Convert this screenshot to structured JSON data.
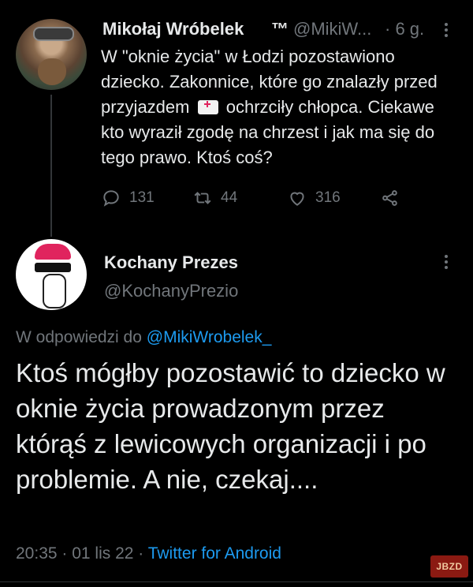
{
  "tweet1": {
    "author_name": "Mikołaj Wróbelek",
    "trademark": "™",
    "handle": "@MikiW...",
    "time": "· 6 g.",
    "text_before_emoji": "W \"oknie życia\" w Łodzi pozostawiono dziecko. Zakonnice, które go znalazły przed przyjazdem",
    "emoji_icon": "ambulance-icon",
    "text_after_emoji": "ochrzciły chłopca. Ciekawe kto wyraził zgodę na chrzest i jak ma się do tego prawo. Ktoś coś?",
    "replies": "131",
    "retweets": "44",
    "likes": "316"
  },
  "tweet2": {
    "author_name": "Kochany Prezes",
    "handle": "@KochanyPrezio",
    "reply_prefix": "W odpowiedzi do ",
    "reply_mention": "@MikiWrobelek_",
    "text": "Ktoś mógłby pozostawić to dziecko w oknie życia prowadzonym przez którąś z lewicowych organizacji i po problemie. A nie, czekaj....",
    "time": "20:35 · 01 lis 22 · ",
    "source": "Twitter for Android"
  },
  "watermark": "JBZD",
  "colors": {
    "background": "#000000",
    "text": "#e7e9ea",
    "muted": "#71767b",
    "link": "#1d9bf0"
  }
}
